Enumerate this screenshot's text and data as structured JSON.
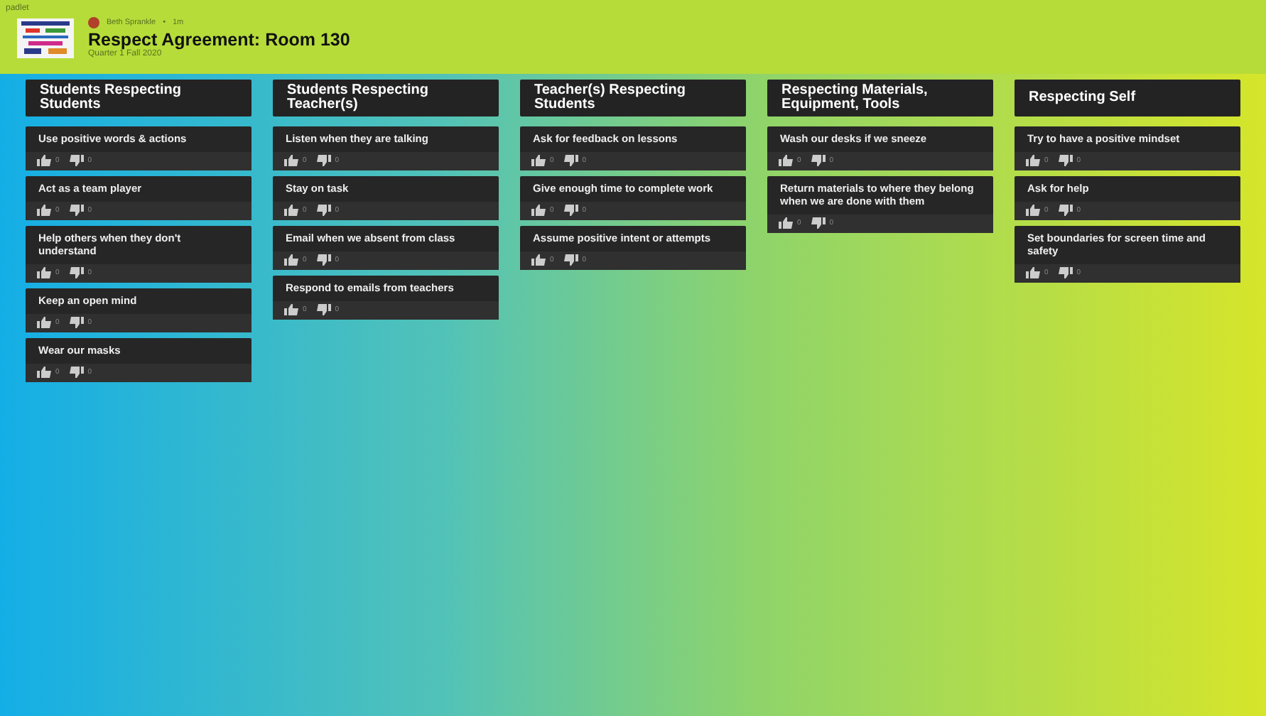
{
  "brand": "padlet",
  "header": {
    "author": "Beth Sprankle",
    "separator": "•",
    "time": "1m",
    "title": "Respect Agreement: Room 130",
    "subtitle": "Quarter 1 Fall 2020"
  },
  "columns": [
    {
      "title": "Students Respecting Students",
      "posts": [
        {
          "text": "Use positive words & actions",
          "likes": "0",
          "dislikes": "0"
        },
        {
          "text": "Act as a team player",
          "likes": "0",
          "dislikes": "0"
        },
        {
          "text": "Help others when they don't understand",
          "likes": "0",
          "dislikes": "0"
        },
        {
          "text": "Keep an open mind",
          "likes": "0",
          "dislikes": "0"
        },
        {
          "text": "Wear our masks",
          "likes": "0",
          "dislikes": "0"
        }
      ]
    },
    {
      "title": "Students Respecting Teacher(s)",
      "posts": [
        {
          "text": "Listen when they are talking",
          "likes": "0",
          "dislikes": "0"
        },
        {
          "text": "Stay on task",
          "likes": "0",
          "dislikes": "0"
        },
        {
          "text": "Email when we absent from class",
          "likes": "0",
          "dislikes": "0"
        },
        {
          "text": "Respond to emails from teachers",
          "likes": "0",
          "dislikes": "0"
        }
      ]
    },
    {
      "title": "Teacher(s) Respecting Students",
      "posts": [
        {
          "text": "Ask for feedback on lessons",
          "likes": "0",
          "dislikes": "0"
        },
        {
          "text": "Give enough time to complete work",
          "likes": "0",
          "dislikes": "0"
        },
        {
          "text": "Assume positive intent or attempts",
          "likes": "0",
          "dislikes": "0"
        }
      ]
    },
    {
      "title": "Respecting Materials, Equipment, Tools",
      "posts": [
        {
          "text": "Wash our desks if we sneeze",
          "likes": "0",
          "dislikes": "0"
        },
        {
          "text": "Return materials to where they belong when we are done with them",
          "likes": "0",
          "dislikes": "0"
        }
      ]
    },
    {
      "title": "Respecting Self",
      "posts": [
        {
          "text": "Try to have a positive mindset",
          "likes": "0",
          "dislikes": "0"
        },
        {
          "text": "Ask for help",
          "likes": "0",
          "dislikes": "0"
        },
        {
          "text": "Set boundaries for screen time and safety",
          "likes": "0",
          "dislikes": "0"
        }
      ]
    }
  ]
}
